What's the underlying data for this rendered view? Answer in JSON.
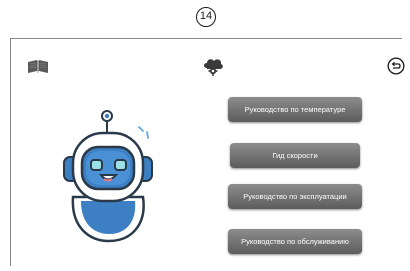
{
  "page_number": "14",
  "header": {
    "left_icon": "book-icon",
    "center_icon": "cloud-gear-icon",
    "right_icon": "back-arrow-icon"
  },
  "illustration": "robot-icon",
  "menu": {
    "items": [
      {
        "label": "Руководство по температуре"
      },
      {
        "label": "Гид скорости"
      },
      {
        "label": "Руководство по эксплуатации"
      },
      {
        "label": "Руководство по обслуживанию"
      }
    ]
  },
  "colors": {
    "button_top": "#8d8d8d",
    "button_bottom": "#5c5c5c",
    "robot_blue": "#3c7fc2",
    "robot_dark": "#2a3a4a",
    "robot_highlight": "#9be0e6"
  }
}
